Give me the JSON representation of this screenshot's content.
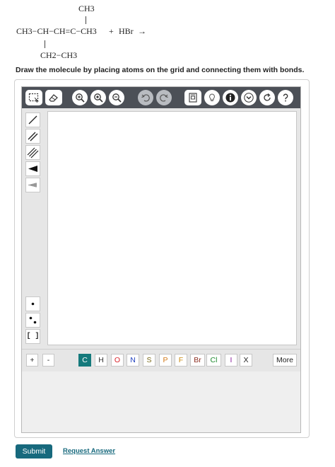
{
  "reaction": {
    "top_group": "CH3",
    "main_chain": "CH3−CH−CH=C−CH3",
    "plus": "+",
    "reagent": "HBr",
    "arrow": "→",
    "bottom_group": "CH2−CH3"
  },
  "instruction": "Draw the molecule by placing atoms on the grid and connecting them with bonds.",
  "toolbar": {
    "icons": [
      "select-lasso-icon",
      "eraser-icon",
      "zoom-in-icon",
      "zoom-fit-icon",
      "zoom-out-icon",
      "undo-icon",
      "redo-icon",
      "template-icon",
      "hint-icon",
      "info-icon",
      "chevron-down-icon",
      "reset-icon",
      "help-icon"
    ]
  },
  "left_tools": {
    "icons": [
      "single-bond-icon",
      "double-bond-icon",
      "triple-bond-icon",
      "wedge-bond-icon",
      "hash-bond-icon",
      "radical-dot-icon",
      "lone-pair-icon",
      "bracket-icon"
    ],
    "bracket_label": "[ ]"
  },
  "atom_bar": {
    "plus": "+",
    "minus": "-",
    "atoms": [
      {
        "symbol": "C",
        "color": "#ffffff",
        "selected": true
      },
      {
        "symbol": "H",
        "color": "#333333"
      },
      {
        "symbol": "O",
        "color": "#d8232a"
      },
      {
        "symbol": "N",
        "color": "#1f3fbf"
      },
      {
        "symbol": "S",
        "color": "#7a6a1a"
      },
      {
        "symbol": "P",
        "color": "#d37a18"
      },
      {
        "symbol": "F",
        "color": "#c98a12"
      },
      {
        "symbol": "Br",
        "color": "#8b2b1e"
      },
      {
        "symbol": "Cl",
        "color": "#1f8a2f"
      },
      {
        "symbol": "I",
        "color": "#8a1f9a"
      },
      {
        "symbol": "X",
        "color": "#222222"
      }
    ],
    "more": "More"
  },
  "actions": {
    "submit": "Submit",
    "request_answer": "Request Answer"
  },
  "colors": {
    "accent": "#17697d",
    "toolbar": "#4c5057",
    "selected_atom": "#157a7c"
  }
}
